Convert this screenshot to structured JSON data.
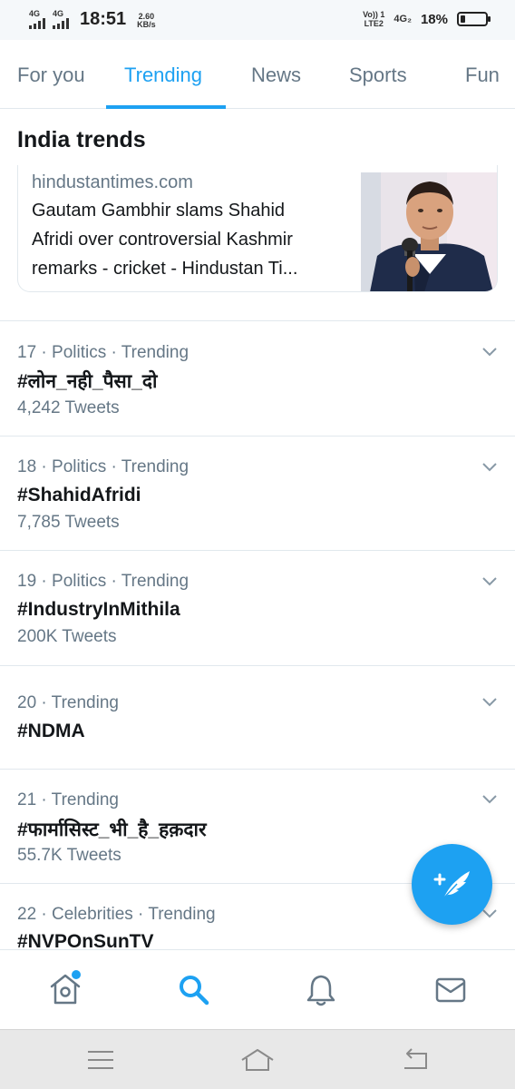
{
  "status_bar": {
    "sim1_label": "4G",
    "sim2_label": "4G",
    "time": "18:51",
    "speed_value": "2.60",
    "speed_unit": "KB/s",
    "volte_line1": "Vo)) 1",
    "volte_line2": "LTE2",
    "network_label": "4G₂",
    "battery_percent": "18%",
    "battery_level": 0.18
  },
  "tabs": [
    {
      "label": "For you",
      "active": false
    },
    {
      "label": "Trending",
      "active": true
    },
    {
      "label": "News",
      "active": false
    },
    {
      "label": "Sports",
      "active": false
    },
    {
      "label": "Fun",
      "active": false
    }
  ],
  "section_title": "India trends",
  "news_card": {
    "source": "hindustantimes.com",
    "headline_lines": [
      "Gautam Gambhir slams Shahid",
      "Afridi over controversial Kashmir",
      "remarks - cricket - Hindustan Ti..."
    ]
  },
  "trends": [
    {
      "meta": "17 · Politics · Trending",
      "tag": "#लोन_नही_पैसा_दो",
      "count": "4,242 Tweets"
    },
    {
      "meta": "18 · Politics · Trending",
      "tag": "#ShahidAfridi",
      "count": "7,785 Tweets"
    },
    {
      "meta": "19 · Politics · Trending",
      "tag": "#IndustryInMithila",
      "count": "200K Tweets"
    },
    {
      "meta": "20 · Trending",
      "tag": "#NDMA",
      "count": ""
    },
    {
      "meta": "21 · Trending",
      "tag": "#फार्मासिस्ट_भी_है_हक़दार",
      "count": "55.7K Tweets"
    },
    {
      "meta": "22 · Celebrities · Trending",
      "tag": "#NVPOnSunTV",
      "count": ""
    }
  ],
  "bottom_nav": [
    {
      "icon": "home-icon",
      "active": false,
      "has_badge": true
    },
    {
      "icon": "search-icon",
      "active": true,
      "has_badge": false
    },
    {
      "icon": "bell-icon",
      "active": false,
      "has_badge": false
    },
    {
      "icon": "mail-icon",
      "active": false,
      "has_badge": false
    }
  ],
  "system_nav": [
    {
      "icon": "menu-icon"
    },
    {
      "icon": "home-outline-icon"
    },
    {
      "icon": "back-icon"
    }
  ],
  "colors": {
    "accent": "#1da1f2",
    "text_primary": "#14171a",
    "text_secondary": "#657786",
    "divider": "#e1e8ed"
  },
  "fab": {
    "icon": "compose-tweet-icon"
  }
}
